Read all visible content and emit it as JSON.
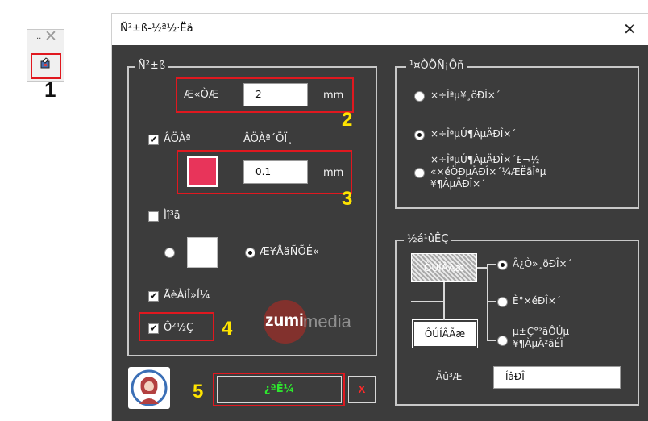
{
  "mini_window": {
    "dots": "..",
    "close_glyph": "✕",
    "callout": "1"
  },
  "dialog": {
    "title": "Ñ²±ß-½ª½·Ëâ",
    "close_glyph": "✕",
    "border_group": {
      "legend": "Ñ²±ß",
      "thickness_label": "Æ«ÒÆ",
      "thickness_value": "2",
      "thickness_unit": "mm",
      "callout_2": "2",
      "outline_check_label": "ÂÖÀª",
      "outline_width_label": "ÂÖÀª´ÖÏ¸",
      "outline_color": "#e8345a",
      "outline_width_value": "0.1",
      "outline_width_unit": "mm",
      "callout_3": "3",
      "fill_check_label": "Ìî³ä",
      "fill_radio_label": "Æ¥ÅäÑÕÉ«",
      "fill_color": "#ffffff",
      "shape_check_label": "ÃèÀìÎ»Í¼",
      "shape_check_checked": true,
      "last_check_label": "Ô²½Ç",
      "last_check_checked": true,
      "callout_4": "4"
    },
    "watermark": {
      "mark": "zumi",
      "text": "media"
    },
    "apply_group": {
      "legend": "¹¤ÒÕÑ¡Ôñ",
      "options": [
        {
          "label": "×÷Îªµ¥¸öÐÎ×´",
          "selected": false
        },
        {
          "label": "×÷ÎªµÚ¶ÀµÄÐÎ×´",
          "selected": true
        },
        {
          "label_lines": [
            "×÷ÎªµÚ¶ÀµÄÐÎ×´£¬½",
            "«×éÖÐµÄÐÎ×´¼ÆËãÎªµ",
            "¥¶ÀµÄÐÎ×´"
          ],
          "selected": false
        }
      ]
    },
    "position_group": {
      "legend": "½á¹ûÊÇ",
      "top_box": "ÔÚÍÂÃæ",
      "bottom_box": "ÔÚÍÂÃæ",
      "options": [
        {
          "label": "Ã¿Ò»¸öÐÎ×´",
          "selected": true
        },
        {
          "label": "È°×éÐÎ×´",
          "selected": false
        },
        {
          "label_lines": [
            "µ±Ç°²ãÔÚµ",
            "¥¶ÀµÄ²ãÉÏ"
          ],
          "selected": false
        }
      ],
      "name_label": "Ãû³Æ",
      "name_value": "ÍâÐÎ"
    },
    "footer": {
      "callout_5": "5",
      "confirm_label": "¿ªÊ¼",
      "cancel_label": "X"
    }
  }
}
